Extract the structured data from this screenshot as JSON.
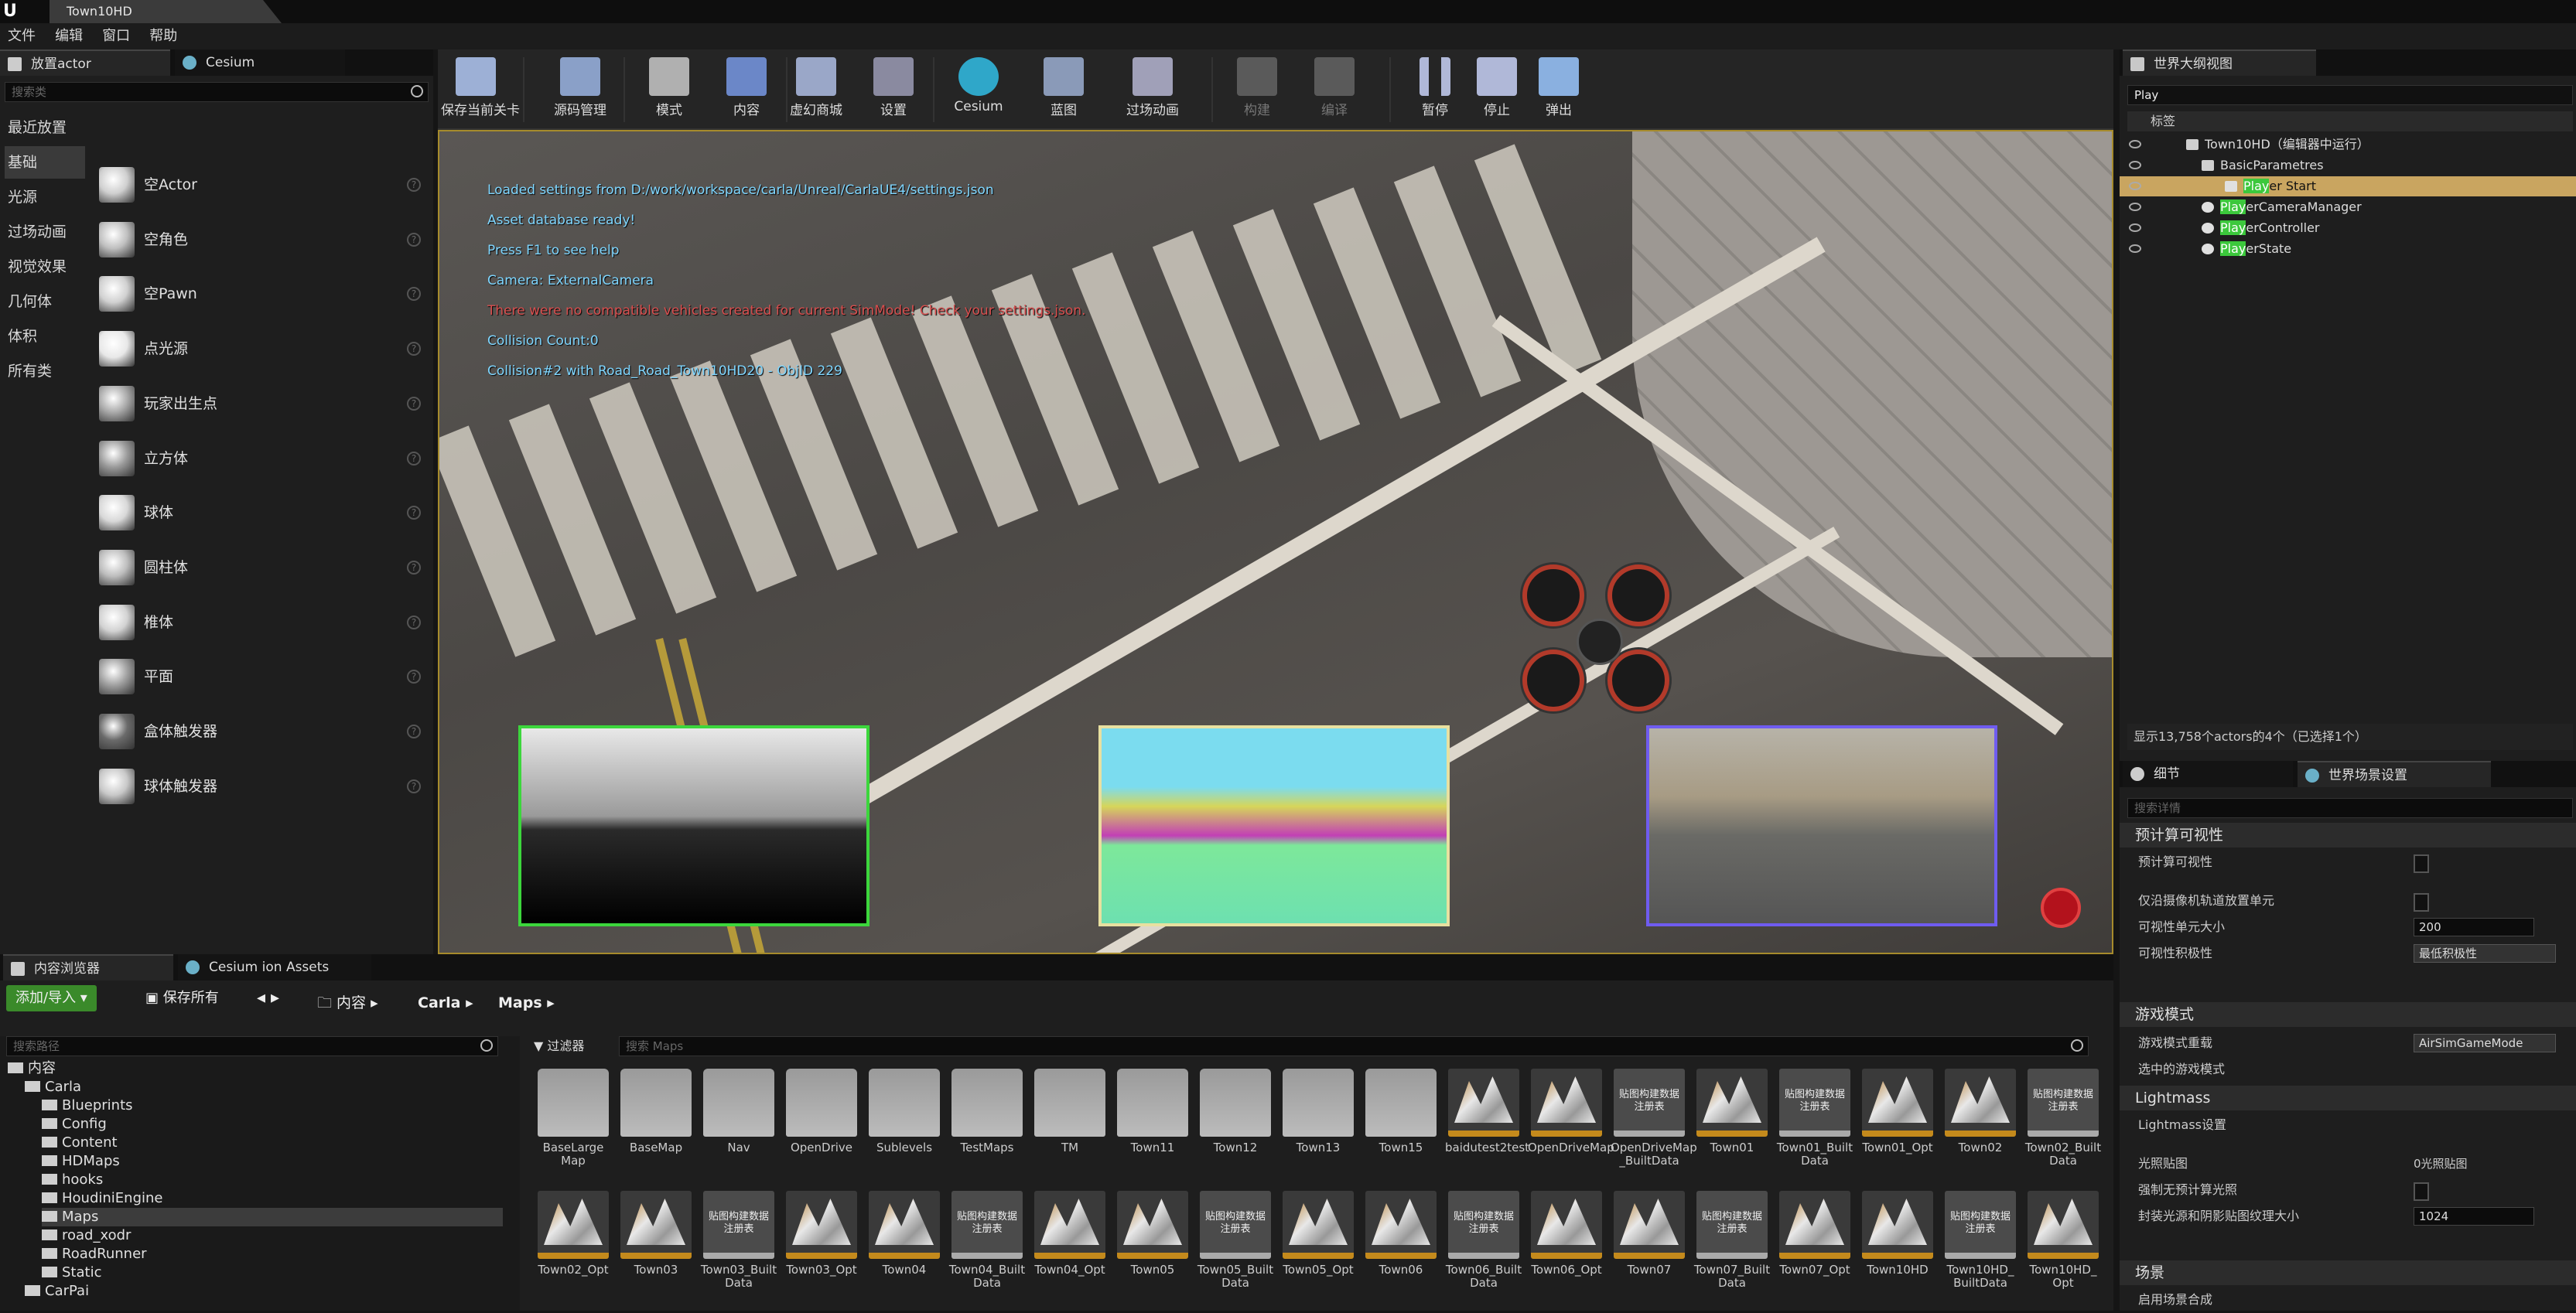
{
  "titlebar": {
    "tab": "Town10HD"
  },
  "menu": [
    "文件",
    "编辑",
    "窗口",
    "帮助"
  ],
  "place_panel": {
    "tabs": [
      "放置actor",
      "Cesium"
    ],
    "search_placeholder": "搜索类",
    "categories": [
      "最近放置",
      "基础",
      "光源",
      "过场动画",
      "视觉效果",
      "几何体",
      "体积",
      "所有类"
    ],
    "selected_category": "基础",
    "items": [
      "空Actor",
      "空角色",
      "空Pawn",
      "点光源",
      "玩家出生点",
      "立方体",
      "球体",
      "圆柱体",
      "椎体",
      "平面",
      "盒体触发器",
      "球体触发器"
    ]
  },
  "toolbar": {
    "buttons": [
      {
        "label": "保存当前关卡",
        "icon": "save-icon"
      },
      {
        "label": "源码管理",
        "icon": "source-control-icon"
      },
      {
        "label": "模式",
        "icon": "modes-icon"
      },
      {
        "label": "内容",
        "icon": "content-icon"
      },
      {
        "label": "虚幻商城",
        "icon": "marketplace-icon"
      },
      {
        "label": "设置",
        "icon": "settings-icon"
      },
      {
        "label": "Cesium",
        "icon": "cesium-icon"
      },
      {
        "label": "蓝图",
        "icon": "blueprint-icon"
      },
      {
        "label": "过场动画",
        "icon": "cinematics-icon"
      },
      {
        "label": "构建",
        "icon": "build-icon"
      },
      {
        "label": "编译",
        "icon": "compile-icon"
      },
      {
        "label": "暂停",
        "icon": "pause-icon"
      },
      {
        "label": "停止",
        "icon": "stop-icon"
      },
      {
        "label": "弹出",
        "icon": "eject-icon"
      }
    ]
  },
  "viewport": {
    "log": [
      "Loaded settings from D:/work/workspace/carla/Unreal/CarlaUE4/settings.json",
      "Asset database ready!",
      "Press F1 to see help",
      "Camera: ExternalCamera",
      "There were no compatible vehicles created for current SimMode! Check your settings.json.",
      "Collision Count:0",
      "Collision#2 with Road_Road_Town10HD20 - ObjID 229"
    ],
    "colors": {
      "info": "#7fd6ff",
      "error": "#d94f4f",
      "cam1_border": "#3cd63c",
      "cam2_border": "#e8e0a0",
      "cam3_border": "#6f5cf0"
    }
  },
  "outliner": {
    "tab": "世界大纲视图",
    "search_value": "Play",
    "column": "标签",
    "rows": [
      {
        "pre": "",
        "hl": "",
        "post": "Town10HD（编辑器中运行）"
      },
      {
        "pre": "",
        "hl": "",
        "post": "BasicParametres"
      },
      {
        "pre": "",
        "hl": "Play",
        "post": "er Start"
      },
      {
        "pre": "",
        "hl": "Play",
        "post": "erCameraManager"
      },
      {
        "pre": "",
        "hl": "Play",
        "post": "erController"
      },
      {
        "pre": "",
        "hl": "Play",
        "post": "erState"
      }
    ],
    "status": "显示13,758个actors的4个（已选择1个）"
  },
  "details": {
    "tabs": [
      "细节",
      "世界场景设置"
    ],
    "search_placeholder": "搜索详情",
    "sections": {
      "precomputed_visibility": "预计算可视性",
      "game_mode": "游戏模式",
      "lightmass": "Lightmass",
      "scene": "场景"
    },
    "props": {
      "precomputed_visibility": "预计算可视性",
      "camera_track_cells": "仅沿摄像机轨道放置单元",
      "cell_size_label": "可视性单元大小",
      "cell_size_value": "200",
      "aggressiveness_label": "可视性积极性",
      "aggressiveness_value": "最低积极性",
      "game_mode_override_label": "游戏模式重载",
      "game_mode_override_value": "AirSimGameMode",
      "selected_game_mode": "选中的游戏模式",
      "lightmass_settings": "Lightmass设置",
      "light_maps": "光照贴图",
      "light_maps_value": "0光照贴图",
      "force_no_precomputed": "强制无预计算光照",
      "packed_texture_label": "封装光源和阴影贴图纹理大小",
      "packed_texture_value": "1024",
      "scene_first": "启用场景合成"
    }
  },
  "content_browser": {
    "tabs": [
      "内容浏览器",
      "Cesium ion Assets"
    ],
    "add_import": "添加/导入",
    "save_all": "保存所有",
    "breadcrumb": [
      "内容",
      "Carla",
      "Maps"
    ],
    "path_search_placeholder": "搜索路径",
    "filters": "过滤器",
    "asset_search_placeholder": "搜索 Maps",
    "tree": [
      {
        "label": "内容",
        "level": 0
      },
      {
        "label": "Carla",
        "level": 1
      },
      {
        "label": "Blueprints",
        "level": 2
      },
      {
        "label": "Config",
        "level": 2
      },
      {
        "label": "Content",
        "level": 2
      },
      {
        "label": "HDMaps",
        "level": 2
      },
      {
        "label": "hooks",
        "level": 2
      },
      {
        "label": "HoudiniEngine",
        "level": 2
      },
      {
        "label": "Maps",
        "level": 2
      },
      {
        "label": "road_xodr",
        "level": 2
      },
      {
        "label": "RoadRunner",
        "level": 2
      },
      {
        "label": "Static",
        "level": 2
      },
      {
        "label": "CarPai",
        "level": 1
      }
    ],
    "assets_row1": [
      {
        "name": "BaseLarge\nMap",
        "kind": "folder"
      },
      {
        "name": "BaseMap",
        "kind": "folder"
      },
      {
        "name": "Nav",
        "kind": "folder"
      },
      {
        "name": "OpenDrive",
        "kind": "folder"
      },
      {
        "name": "Sublevels",
        "kind": "folder"
      },
      {
        "name": "TestMaps",
        "kind": "folder"
      },
      {
        "name": "TM",
        "kind": "folder"
      },
      {
        "name": "Town11",
        "kind": "folder"
      },
      {
        "name": "Town12",
        "kind": "folder"
      },
      {
        "name": "Town13",
        "kind": "folder"
      },
      {
        "name": "Town15",
        "kind": "folder"
      },
      {
        "name": "baidutest2test",
        "kind": "map"
      },
      {
        "name": "OpenDriveMap",
        "kind": "map"
      },
      {
        "name": "OpenDriveMap\n_BuiltData",
        "kind": "data"
      },
      {
        "name": "Town01",
        "kind": "map"
      },
      {
        "name": "Town01_Built\nData",
        "kind": "data"
      },
      {
        "name": "Town01_Opt",
        "kind": "map"
      },
      {
        "name": "Town02",
        "kind": "map"
      },
      {
        "name": "Town02_Built\nData",
        "kind": "data"
      }
    ],
    "assets_row2": [
      {
        "name": "Town02_Opt",
        "kind": "map"
      },
      {
        "name": "Town03",
        "kind": "map"
      },
      {
        "name": "Town03_Built\nData",
        "kind": "data"
      },
      {
        "name": "Town03_Opt",
        "kind": "map"
      },
      {
        "name": "Town04",
        "kind": "map"
      },
      {
        "name": "Town04_Built\nData",
        "kind": "data"
      },
      {
        "name": "Town04_Opt",
        "kind": "map"
      },
      {
        "name": "Town05",
        "kind": "map"
      },
      {
        "name": "Town05_Built\nData",
        "kind": "data"
      },
      {
        "name": "Town05_Opt",
        "kind": "map"
      },
      {
        "name": "Town06",
        "kind": "map"
      },
      {
        "name": "Town06_Built\nData",
        "kind": "data"
      },
      {
        "name": "Town06_Opt",
        "kind": "map"
      },
      {
        "name": "Town07",
        "kind": "map"
      },
      {
        "name": "Town07_Built\nData",
        "kind": "data"
      },
      {
        "name": "Town07_Opt",
        "kind": "map"
      },
      {
        "name": "Town10HD",
        "kind": "map"
      },
      {
        "name": "Town10HD_\nBuiltData",
        "kind": "data"
      },
      {
        "name": "Town10HD_\nOpt",
        "kind": "map"
      }
    ],
    "data_tile_text": "贴图构建数据\n注册表"
  }
}
